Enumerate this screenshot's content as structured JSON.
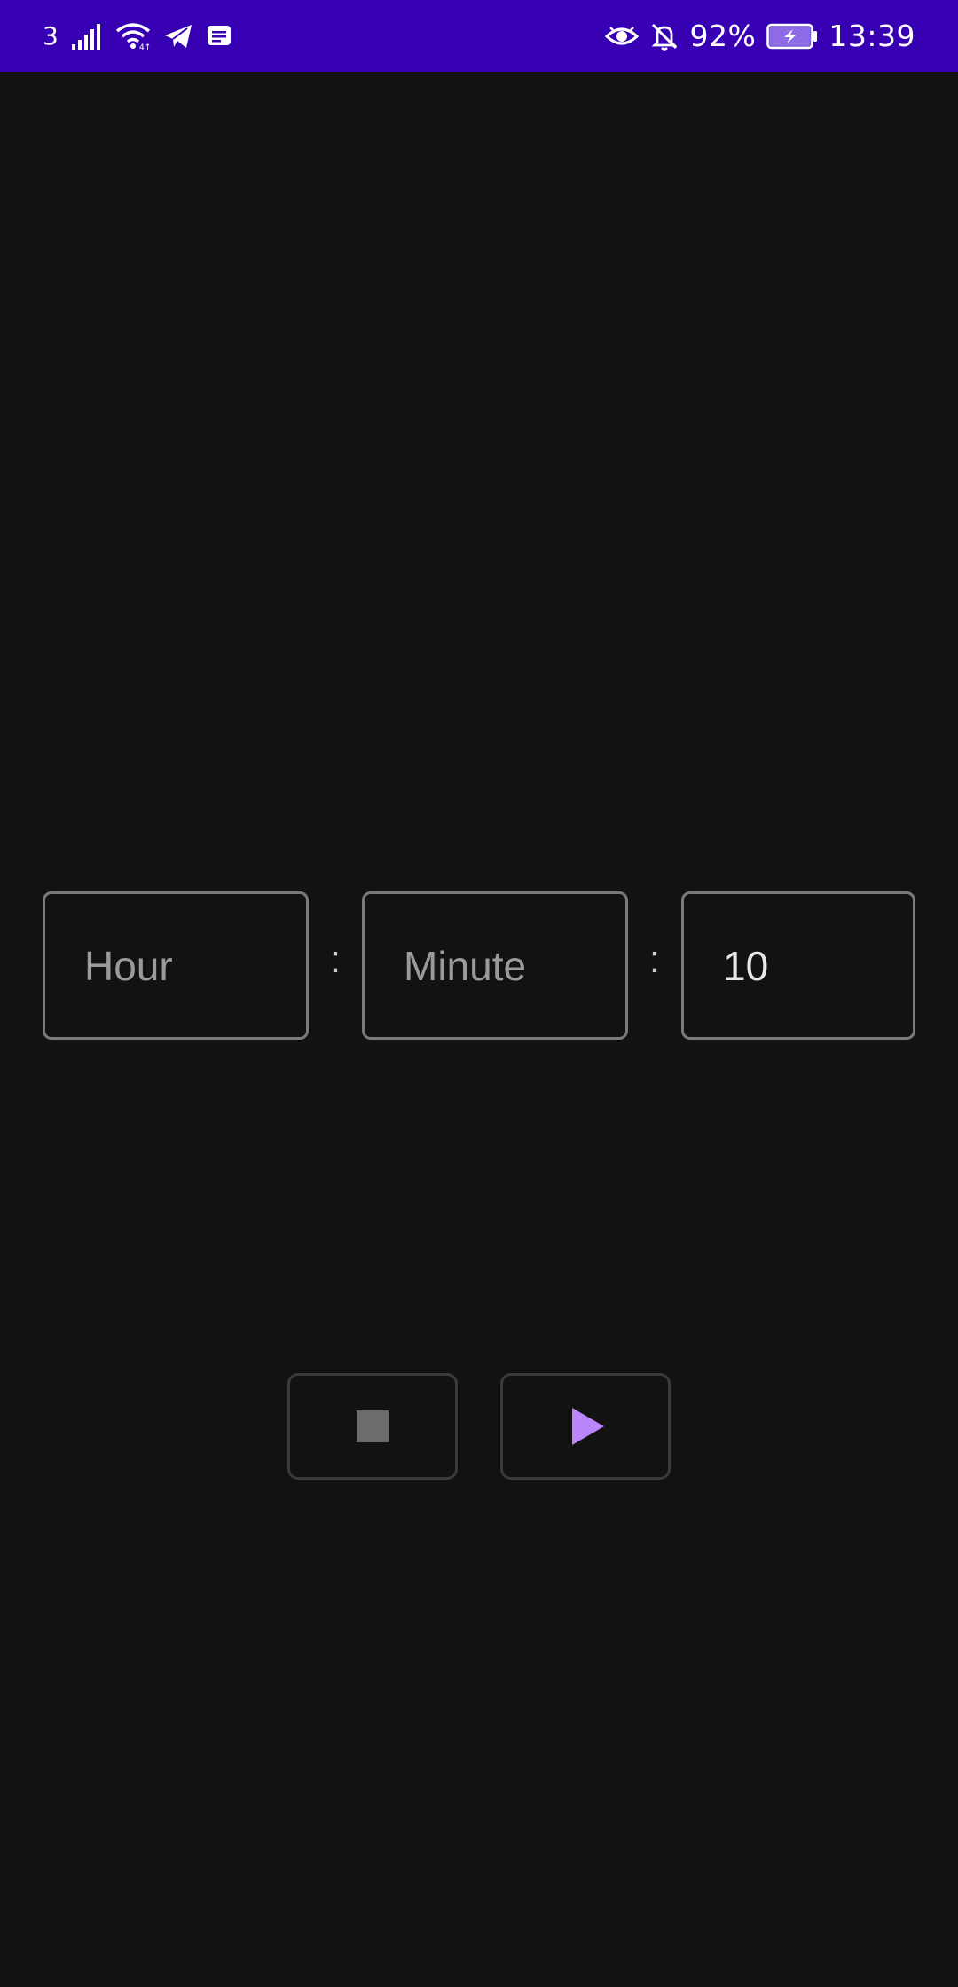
{
  "status_bar": {
    "network_label": "3",
    "battery_percent": "92%",
    "time": "13:39",
    "background_color": "#3700b3",
    "icons": [
      "signal-icon",
      "wifi-icon",
      "telegram-icon",
      "message-icon",
      "eye-icon",
      "bell-off-icon",
      "battery-charging-icon"
    ]
  },
  "timer": {
    "hour": {
      "value": "",
      "placeholder": "Hour"
    },
    "minute": {
      "value": "",
      "placeholder": "Minute"
    },
    "second": {
      "value": "10",
      "placeholder": ""
    },
    "separator": ":"
  },
  "controls": {
    "stop_icon": "stop-icon",
    "play_icon": "play-icon",
    "play_color": "#bb86fc",
    "stop_color": "#6c6c6c"
  },
  "background_color": "#121212"
}
